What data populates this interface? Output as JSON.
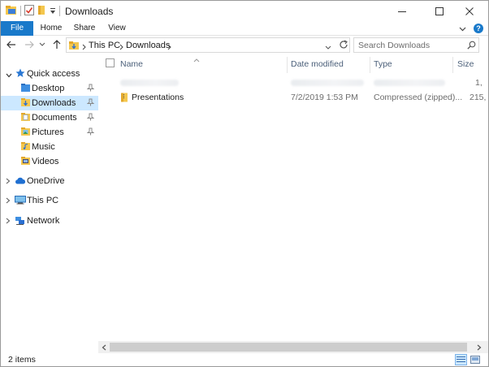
{
  "window": {
    "title": "Downloads"
  },
  "ribbon": {
    "tabs": [
      "File",
      "Home",
      "Share",
      "View"
    ],
    "help_label": "?"
  },
  "address": {
    "crumbs": [
      "This PC",
      "Downloads"
    ]
  },
  "search": {
    "placeholder": "Search Downloads"
  },
  "nav": {
    "quick_access": "Quick access",
    "quick_items": [
      {
        "label": "Desktop",
        "icon": "desktop-folder-icon",
        "pinned": true
      },
      {
        "label": "Downloads",
        "icon": "downloads-folder-icon",
        "pinned": true,
        "selected": true
      },
      {
        "label": "Documents",
        "icon": "documents-folder-icon",
        "pinned": true
      },
      {
        "label": "Pictures",
        "icon": "pictures-folder-icon",
        "pinned": true
      },
      {
        "label": "Music",
        "icon": "music-folder-icon",
        "pinned": false
      },
      {
        "label": "Videos",
        "icon": "videos-folder-icon",
        "pinned": false
      }
    ],
    "onedrive": "OneDrive",
    "this_pc": "This PC",
    "network": "Network"
  },
  "columns": [
    "Name",
    "Date modified",
    "Type",
    "Size"
  ],
  "files": [
    {
      "name": "",
      "date": "",
      "type": "",
      "size": "1,",
      "blurred": true
    },
    {
      "name": "Presentations",
      "date": "7/2/2019 1:53 PM",
      "type": "Compressed (zipped)...",
      "size": "215,",
      "icon": "zip-folder-icon"
    }
  ],
  "status": {
    "item_count": "2 items"
  },
  "colors": {
    "accent": "#1979ca",
    "selection": "#cce8ff",
    "header_text": "#4c607a"
  }
}
